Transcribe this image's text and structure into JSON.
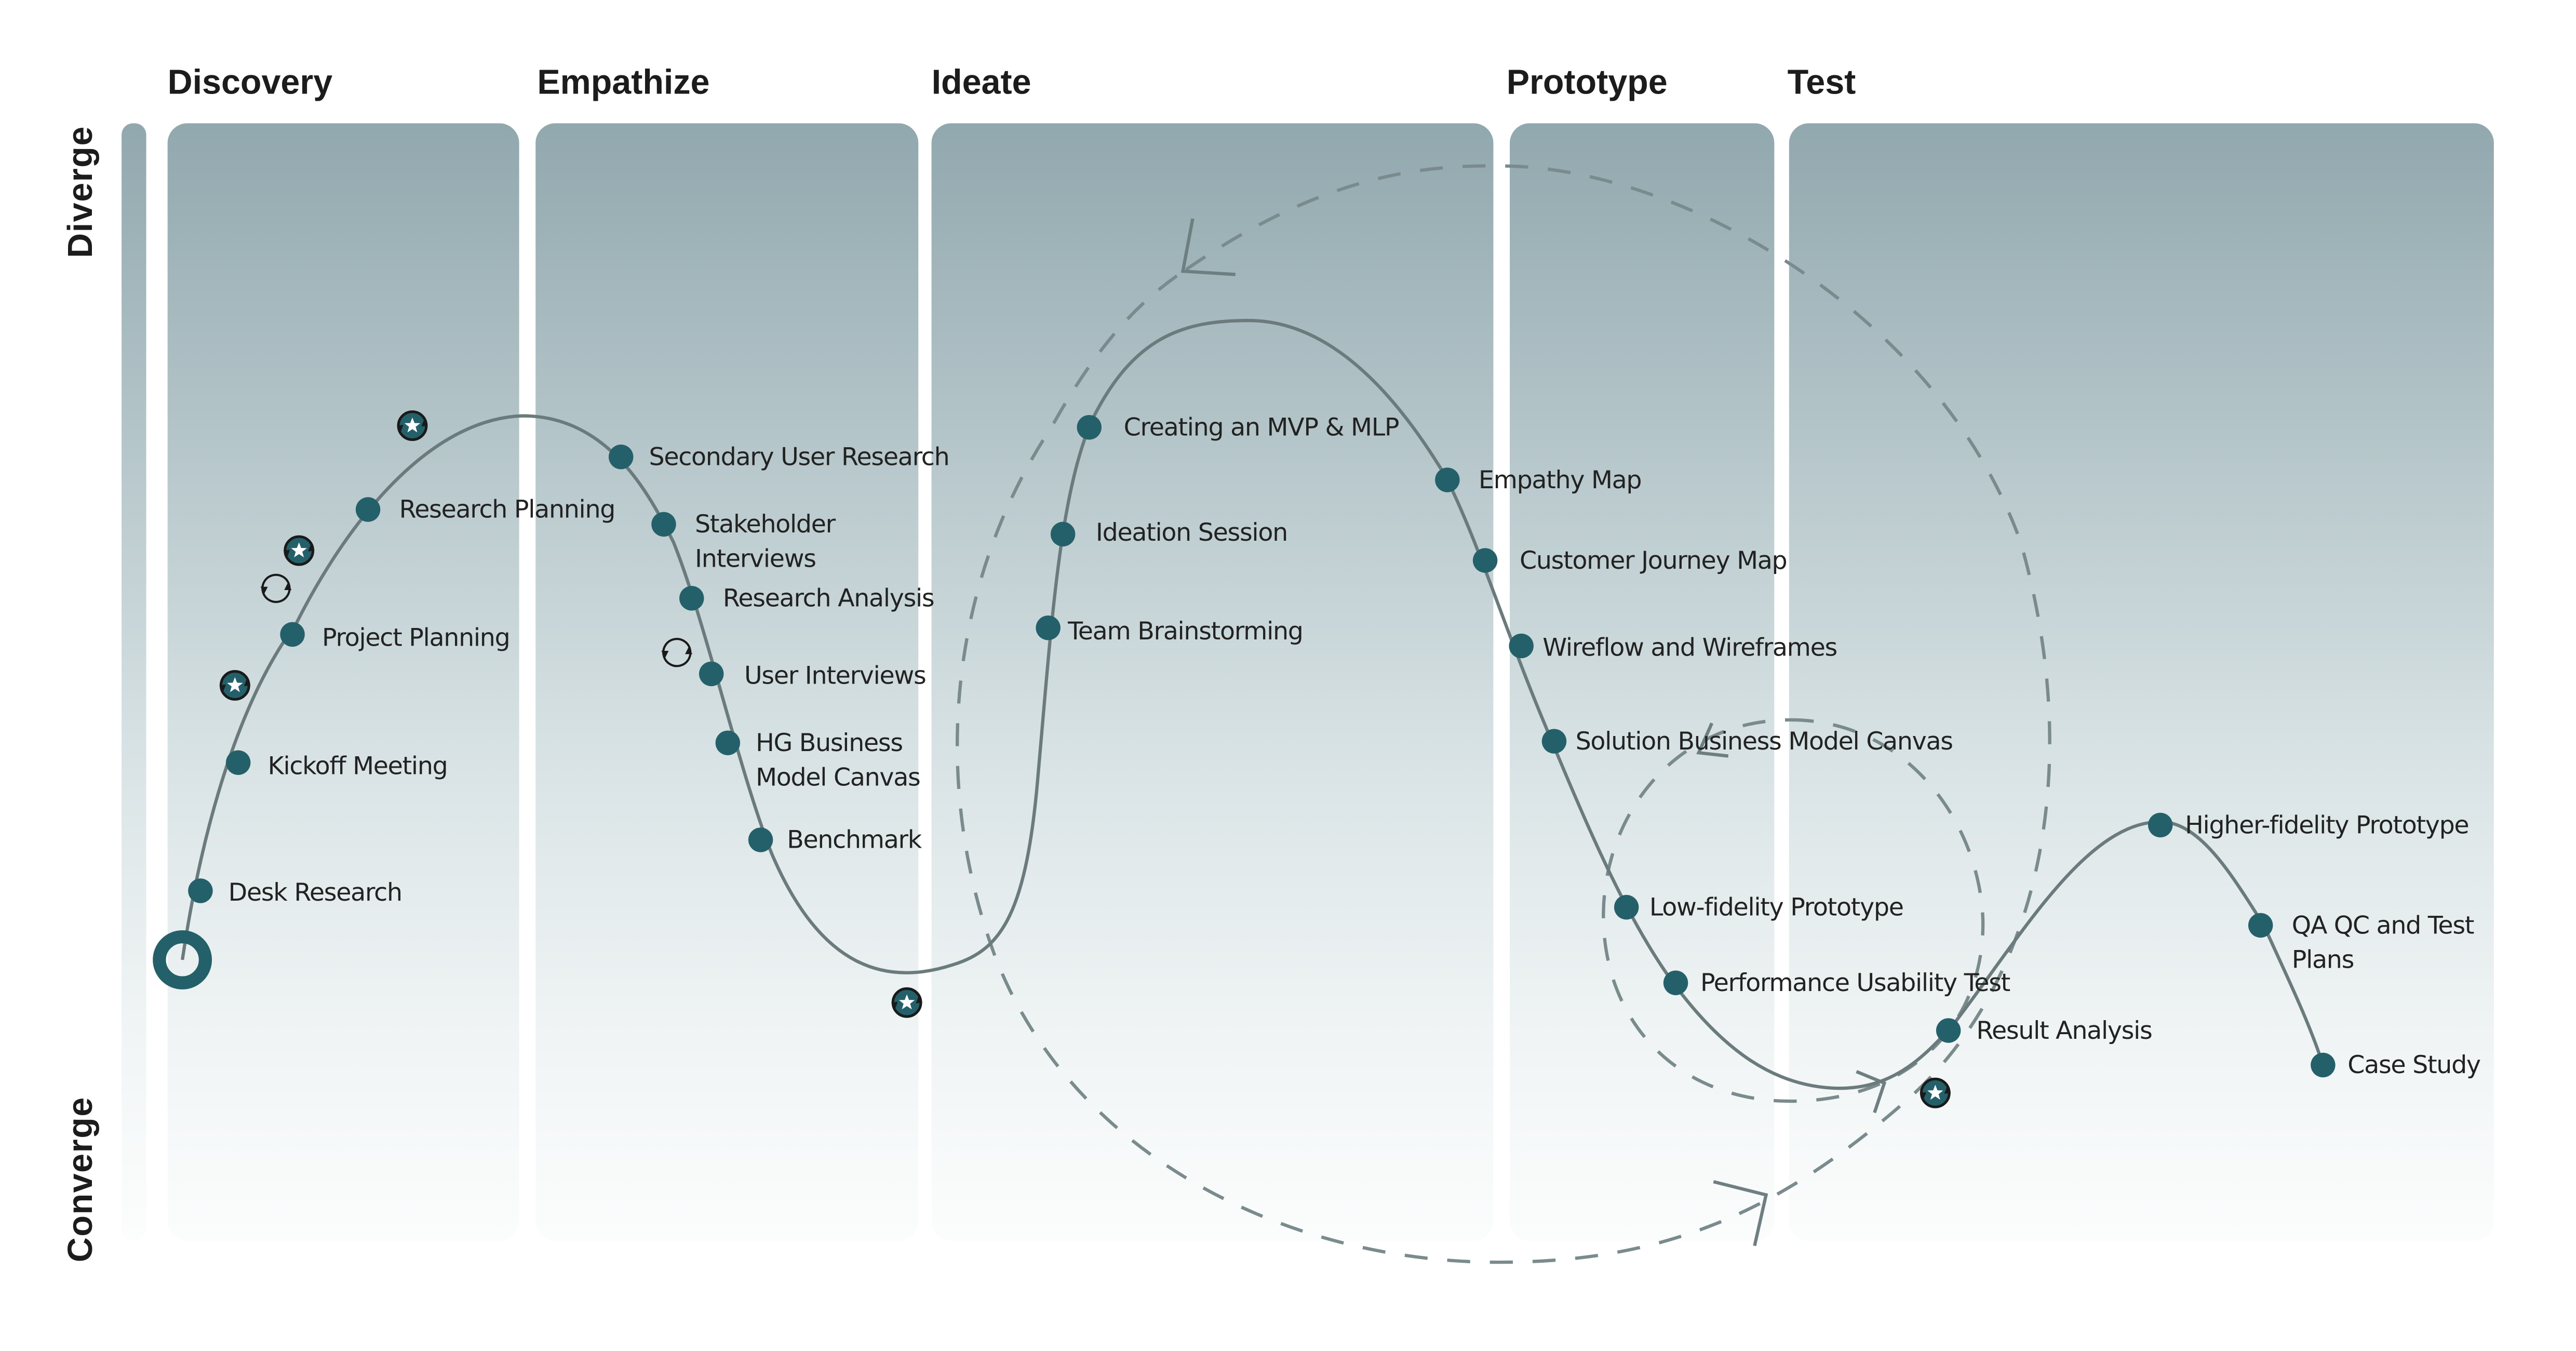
{
  "colors": {
    "node": "#24606a",
    "curve": "#6b7b7d",
    "column_top": "#91a8ae",
    "column_bottom": "#f7fafa",
    "text": "#1c1c1c"
  },
  "axis": {
    "top_label": "Diverge",
    "bottom_label": "Converge"
  },
  "phases": [
    {
      "name": "Discovery"
    },
    {
      "name": "Empathize"
    },
    {
      "name": "Ideate"
    },
    {
      "name": "Prototype"
    },
    {
      "name": "Test"
    }
  ],
  "start_marker": {
    "icon": "start-ring-icon"
  },
  "steps": [
    {
      "label": [
        "Desk Research"
      ],
      "phase": "Discovery"
    },
    {
      "label": [
        "Kickoff Meeting"
      ],
      "phase": "Discovery"
    },
    {
      "label": [
        "Project Planning"
      ],
      "phase": "Discovery"
    },
    {
      "label": [
        "Research Planning"
      ],
      "phase": "Discovery"
    },
    {
      "label": [
        "Secondary User Research"
      ],
      "phase": "Empathize"
    },
    {
      "label": [
        "Stakeholder",
        "Interviews"
      ],
      "phase": "Empathize"
    },
    {
      "label": [
        "Research Analysis"
      ],
      "phase": "Empathize"
    },
    {
      "label": [
        "User Interviews"
      ],
      "phase": "Empathize"
    },
    {
      "label": [
        "HG Business",
        "Model Canvas"
      ],
      "phase": "Empathize"
    },
    {
      "label": [
        "Benchmark"
      ],
      "phase": "Empathize"
    },
    {
      "label": [
        "Team Brainstorming"
      ],
      "phase": "Ideate"
    },
    {
      "label": [
        "Ideation Session"
      ],
      "phase": "Ideate"
    },
    {
      "label": [
        "Creating an MVP & MLP"
      ],
      "phase": "Ideate"
    },
    {
      "label": [
        "Empathy Map"
      ],
      "phase": "Ideate"
    },
    {
      "label": [
        "Customer Journey Map"
      ],
      "phase": "Ideate"
    },
    {
      "label": [
        "Wireflow and Wireframes"
      ],
      "phase": "Prototype"
    },
    {
      "label": [
        "Solution Business Model Canvas"
      ],
      "phase": "Prototype"
    },
    {
      "label": [
        "Low-fidelity Prototype"
      ],
      "phase": "Prototype"
    },
    {
      "label": [
        "Performance Usability Test"
      ],
      "phase": "Prototype"
    },
    {
      "label": [
        "Result Analysis"
      ],
      "phase": "Test"
    },
    {
      "label": [
        "Higher-fidelity Prototype"
      ],
      "phase": "Test"
    },
    {
      "label": [
        "QA QC and Test",
        "Plans"
      ],
      "phase": "Test"
    },
    {
      "label": [
        "Case Study"
      ],
      "phase": "Test"
    }
  ],
  "badges": [
    {
      "icon": "star-iteration-badge-icon",
      "near": "Research Planning"
    },
    {
      "icon": "star-iteration-badge-icon",
      "near": "Project Planning"
    },
    {
      "icon": "cycle-arrows-icon",
      "near": "Project Planning"
    },
    {
      "icon": "star-iteration-badge-icon",
      "near": "Kickoff Meeting"
    },
    {
      "icon": "cycle-arrows-icon",
      "near": "User Interviews"
    },
    {
      "icon": "star-iteration-badge-icon",
      "near": "Benchmark"
    },
    {
      "icon": "star-iteration-badge-icon",
      "near": "Result Analysis"
    }
  ],
  "loops": [
    {
      "name": "large-iteration-loop",
      "style": "dashed",
      "direction": "counter-clockwise"
    },
    {
      "name": "small-iteration-loop",
      "style": "dashed",
      "direction": "counter-clockwise"
    }
  ]
}
